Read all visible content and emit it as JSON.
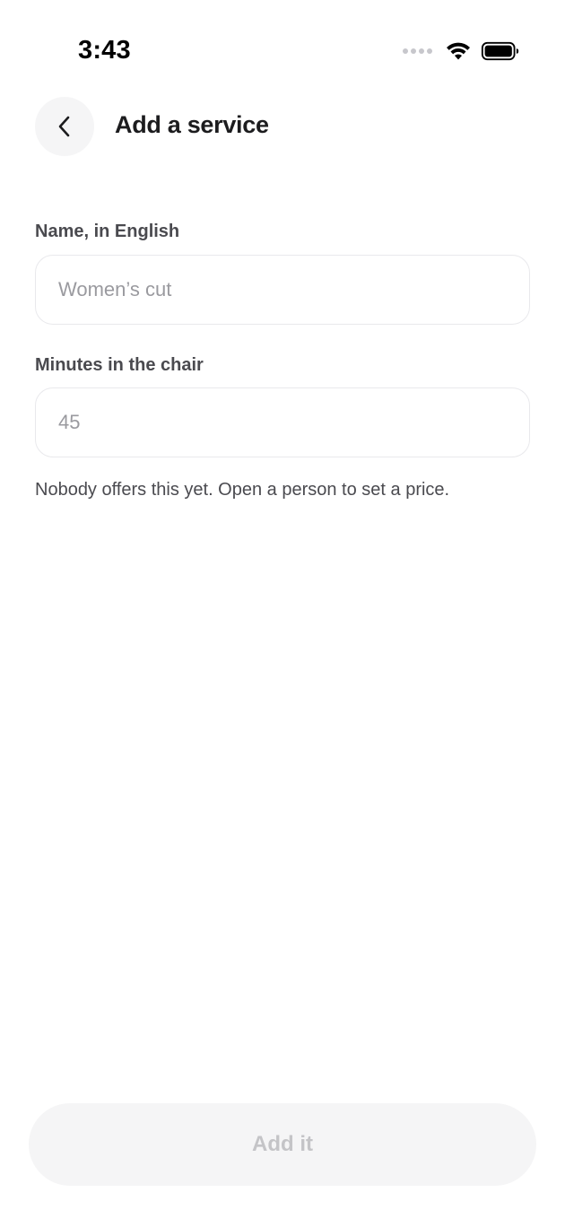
{
  "status_bar": {
    "time": "3:43",
    "icons": [
      "cellular-signal-icon",
      "wifi-icon",
      "battery-icon"
    ]
  },
  "header": {
    "back_icon": "chevron-left-icon",
    "title": "Add a service"
  },
  "form": {
    "name_field": {
      "label": "Name, in English",
      "placeholder": "Women’s cut",
      "value": ""
    },
    "minutes_field": {
      "label": "Minutes in the chair",
      "placeholder": "45",
      "value": ""
    },
    "helper_text": "Nobody offers this yet. Open a person to set a price."
  },
  "footer": {
    "submit_label": "Add it",
    "submit_enabled": false
  },
  "colors": {
    "background": "#ffffff",
    "back_button_bg": "#f5f5f6",
    "input_border": "#e9e9ec",
    "placeholder": "#9a9a9f",
    "disabled_button_bg": "#f5f5f6",
    "disabled_button_text": "#c4c4c7"
  }
}
